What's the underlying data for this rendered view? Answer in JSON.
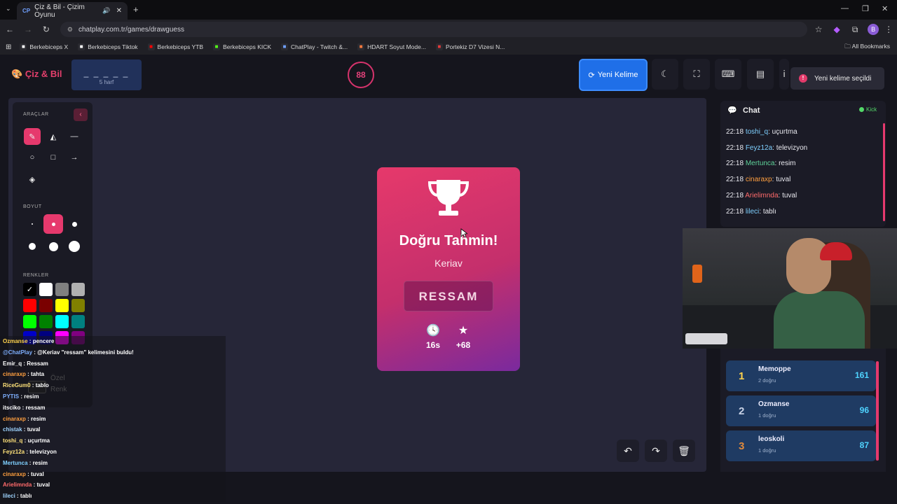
{
  "browser": {
    "tab_title": "Çiz & Bil - Çizim Oyunu",
    "tab_favicon": "CP",
    "url": "chatplay.com.tr/games/drawguess",
    "bookmarks": [
      {
        "label": "Berkebiceps X",
        "icon": "x-icon",
        "color": "#ffffff"
      },
      {
        "label": "Berkebiceps Tiktok",
        "icon": "tiktok-icon",
        "color": "#ffffff"
      },
      {
        "label": "Berkebiceps YTB",
        "icon": "youtube-icon",
        "color": "#ff0000"
      },
      {
        "label": "Berkebiceps KICK",
        "icon": "kick-icon",
        "color": "#53fc18"
      },
      {
        "label": "ChatPlay - Twitch &...",
        "icon": "chatplay-icon",
        "color": "#6fa0ff"
      },
      {
        "label": "HDART Soyut Mode...",
        "icon": "hdart-icon",
        "color": "#ff7a3d"
      },
      {
        "label": "Portekiz D7 Vizesi N...",
        "icon": "doc-icon",
        "color": "#e23a3a"
      }
    ],
    "all_bookmarks": "All Bookmarks",
    "profile_letter": "B"
  },
  "header": {
    "logo": "Çiz & Bil",
    "word_mask": "_ _ _ _ _",
    "word_letters": "5 harf",
    "timer": "88",
    "new_word_label": "Yeni Kelime",
    "toast": "Yeni kelime seçildi"
  },
  "tools": {
    "tools_title": "ARAÇLAR",
    "size_title": "BOYUT",
    "colors_title": "RENKLER",
    "custom_color": "Özel Renk",
    "colors": [
      "#000000",
      "#ffffff",
      "#808080",
      "#b0b0b0",
      "#ff0000",
      "#7a0000",
      "#ffff00",
      "#808000",
      "#00ff00",
      "#008000",
      "#00ffff",
      "#008080"
    ]
  },
  "stream_chat": [
    {
      "user": "Ozmanse",
      "text": "pencere",
      "color": "#ffd24d"
    },
    {
      "user": "@ChatPlay",
      "text": "@Keriav \"ressam\" kelimesini buldu!",
      "color": "#7fb0ff"
    },
    {
      "user": "Emir_q",
      "text": "Ressam",
      "color": "#ffffff"
    },
    {
      "user": "cinaraxp",
      "text": "tahta",
      "color": "#ff9f3f"
    },
    {
      "user": "RiceGum0",
      "text": "tablo",
      "color": "#ffe27a"
    },
    {
      "user": "PYTIS",
      "text": "resim",
      "color": "#7fb0ff"
    },
    {
      "user": "itsciko",
      "text": "ressam",
      "color": "#ffffff"
    },
    {
      "user": "cinaraxp",
      "text": "resim",
      "color": "#ff9f3f"
    },
    {
      "user": "chistak",
      "text": "tuval",
      "color": "#9fd4ff"
    },
    {
      "user": "toshi_q",
      "text": "uçurtma",
      "color": "#ffe27a"
    },
    {
      "user": "Feyz12a",
      "text": "televizyon",
      "color": "#ffe27a"
    },
    {
      "user": "Mertunca",
      "text": "resim",
      "color": "#7fd0ff"
    },
    {
      "user": "cinaraxp",
      "text": "tuval",
      "color": "#ff9f3f"
    },
    {
      "user": "Arielimnda",
      "text": "tuval",
      "color": "#ff6b6b"
    },
    {
      "user": "lileci",
      "text": "tablı",
      "color": "#9fd4ff"
    }
  ],
  "card": {
    "title": "Doğru Tahmin!",
    "user": "Keriav",
    "word": "RESSAM",
    "time": "16s",
    "points": "+68"
  },
  "chat": {
    "title": "Chat",
    "platform": "Kick",
    "messages": [
      {
        "time": "22:18",
        "user": "toshi_q",
        "text": "uçurtma",
        "color": "#7fd0ff"
      },
      {
        "time": "22:18",
        "user": "Feyz12a",
        "text": "televizyon",
        "color": "#7fd0ff"
      },
      {
        "time": "22:18",
        "user": "Mertunca",
        "text": "resim",
        "color": "#5fd39a"
      },
      {
        "time": "22:18",
        "user": "cinaraxp",
        "text": "tuval",
        "color": "#ff9f3f"
      },
      {
        "time": "22:18",
        "user": "Arielimnda",
        "text": "tuval",
        "color": "#ff6b6b"
      },
      {
        "time": "22:18",
        "user": "lileci",
        "text": "tablı",
        "color": "#7fd0ff"
      }
    ]
  },
  "leaderboard": [
    {
      "rank": "1",
      "name": "Memoppe",
      "sub": "2 doğru",
      "score": "161",
      "rank_color": "#ffd24d"
    },
    {
      "rank": "2",
      "name": "Ozmanse",
      "sub": "1 doğru",
      "score": "96",
      "rank_color": "#c9d3e6"
    },
    {
      "rank": "3",
      "name": "leoskoli",
      "sub": "1 doğru",
      "score": "87",
      "rank_color": "#e08a3c"
    }
  ]
}
